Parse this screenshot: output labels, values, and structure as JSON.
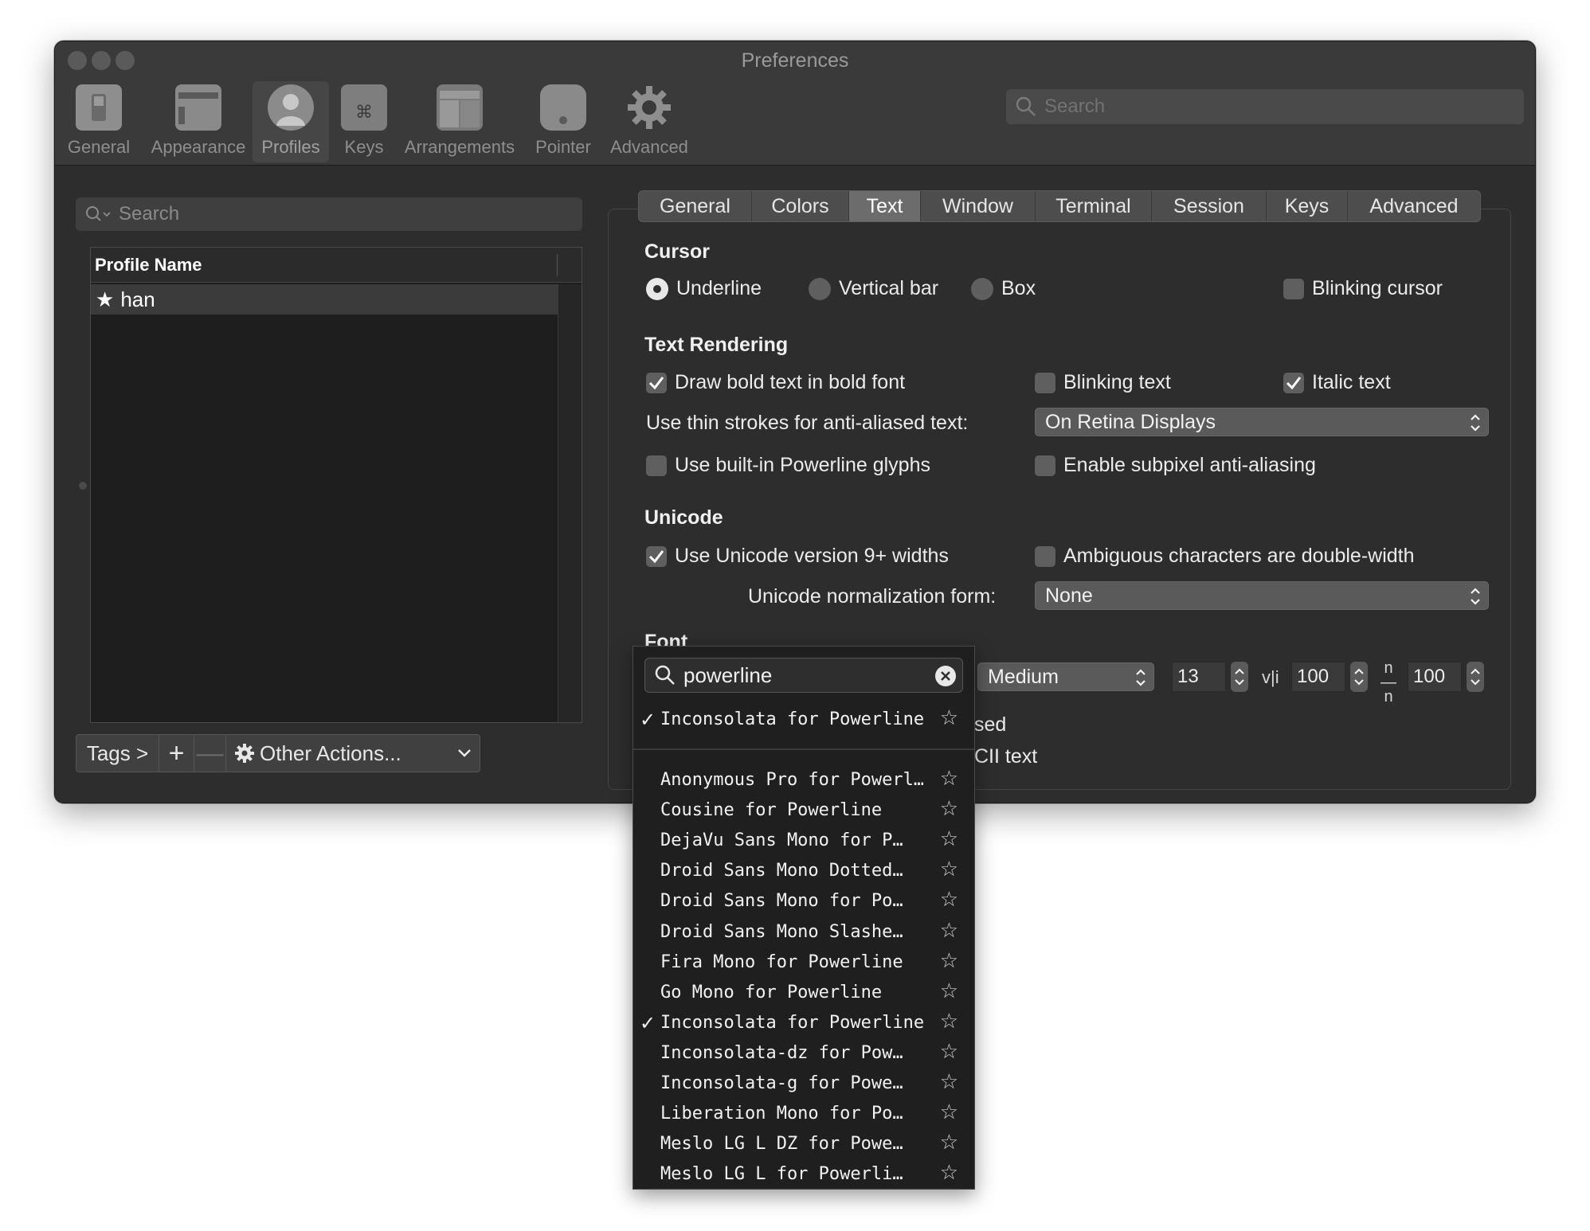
{
  "window": {
    "title": "Preferences"
  },
  "toolbar": {
    "items": [
      {
        "label": "General",
        "icon": "switch-icon"
      },
      {
        "label": "Appearance",
        "icon": "window-icon"
      },
      {
        "label": "Profiles",
        "icon": "person-icon",
        "selected": true
      },
      {
        "label": "Keys",
        "icon": "command-key-icon"
      },
      {
        "label": "Arrangements",
        "icon": "windows-stack-icon"
      },
      {
        "label": "Pointer",
        "icon": "mouse-icon"
      },
      {
        "label": "Advanced",
        "icon": "gear-icon"
      }
    ],
    "search_placeholder": "Search"
  },
  "profiles": {
    "search_placeholder": "Search",
    "column_header": "Profile Name",
    "rows": [
      {
        "name": "han",
        "default": true
      }
    ],
    "tags_label": "Tags >",
    "add_label": "+",
    "remove_label": "—",
    "other_actions_label": "Other Actions..."
  },
  "tabs": [
    "General",
    "Colors",
    "Text",
    "Window",
    "Terminal",
    "Session",
    "Keys",
    "Advanced"
  ],
  "active_tab": "Text",
  "cursor": {
    "title": "Cursor",
    "underline": "Underline",
    "vertical_bar": "Vertical bar",
    "box": "Box",
    "blinking": "Blinking cursor",
    "selected": "Underline",
    "blinking_checked": false
  },
  "rendering": {
    "title": "Text Rendering",
    "bold": {
      "label": "Draw bold text in bold font",
      "checked": true
    },
    "blinking_text": {
      "label": "Blinking text",
      "checked": false
    },
    "italic": {
      "label": "Italic text",
      "checked": true
    },
    "thin_strokes_label": "Use thin strokes for anti-aliased text:",
    "thin_strokes_value": "On Retina Displays",
    "powerline": {
      "label": "Use built-in Powerline glyphs",
      "checked": false
    },
    "subpixel": {
      "label": "Enable subpixel anti-aliasing",
      "checked": false
    }
  },
  "unicode": {
    "title": "Unicode",
    "v9": {
      "label": "Use Unicode version 9+ widths",
      "checked": true
    },
    "ambiguous": {
      "label": "Ambiguous characters are double-width",
      "checked": false
    },
    "norm_label": "Unicode normalization form:",
    "norm_value": "None"
  },
  "font": {
    "title": "Font",
    "weight": "Medium",
    "size": "13",
    "h_spacing": "100",
    "v_spacing": "100",
    "partial_1": "sed",
    "partial_2": "CII text"
  },
  "font_dropdown": {
    "search_value": "powerline",
    "current": "Inconsolata for Powerline",
    "items": [
      {
        "name": "Anonymous Pro for Powerl…",
        "checked": false
      },
      {
        "name": "Cousine for Powerline",
        "checked": false
      },
      {
        "name": "DejaVu Sans Mono for P…",
        "checked": false
      },
      {
        "name": "Droid Sans Mono Dotted…",
        "checked": false
      },
      {
        "name": "Droid Sans Mono for Po…",
        "checked": false
      },
      {
        "name": "Droid Sans Mono Slashe…",
        "checked": false
      },
      {
        "name": "Fira Mono for Powerline",
        "checked": false
      },
      {
        "name": "Go Mono for Powerline",
        "checked": false
      },
      {
        "name": "Inconsolata for Powerline",
        "checked": true
      },
      {
        "name": "Inconsolata-dz for Pow…",
        "checked": false
      },
      {
        "name": "Inconsolata-g for Powe…",
        "checked": false
      },
      {
        "name": "Liberation Mono for Po…",
        "checked": false
      },
      {
        "name": "Meslo LG L DZ for Powe…",
        "checked": false
      },
      {
        "name": "Meslo LG L for Powerli…",
        "checked": false
      }
    ],
    "check_mark": "✓",
    "star": "☆"
  }
}
